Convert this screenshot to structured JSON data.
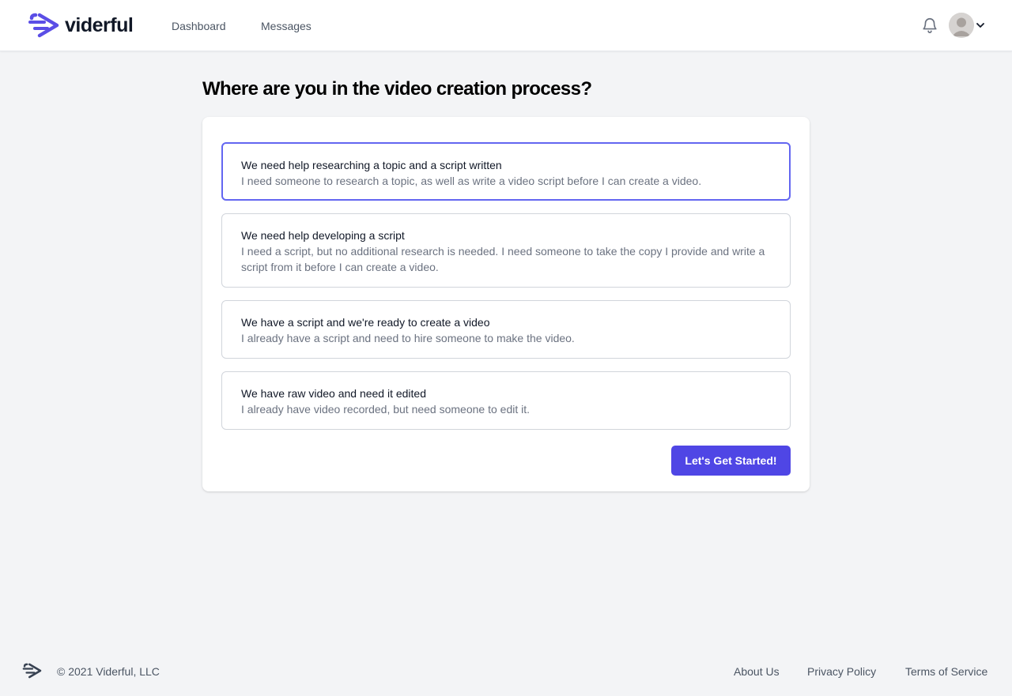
{
  "header": {
    "brand": "viderful",
    "nav": [
      "Dashboard",
      "Messages"
    ],
    "icons": {
      "logo": "viderful-logo-icon",
      "notifications": "bell-icon",
      "avatar": "user-avatar-icon",
      "menu": "chevron-down-icon"
    }
  },
  "main": {
    "title": "Where are you in the video creation process?",
    "options": [
      {
        "title": "We need help researching a topic and a script written",
        "description": "I need someone to research a topic, as well as write a video script before I can create a video.",
        "selected": true
      },
      {
        "title": "We need help developing a script",
        "description": "I need a script, but no additional research is needed. I need someone to take the copy I provide and write a script from it before I can create a video.",
        "selected": false
      },
      {
        "title": "We have a script and we're ready to create a video",
        "description": "I already have a script and need to hire someone to make the video.",
        "selected": false
      },
      {
        "title": "We have raw video and need it edited",
        "description": "I already have video recorded, but need someone to edit it.",
        "selected": false
      }
    ],
    "cta_label": "Let's Get Started!"
  },
  "footer": {
    "copyright": "© 2021 Viderful, LLC",
    "links": [
      "About Us",
      "Privacy Policy",
      "Terms of Service"
    ]
  },
  "colors": {
    "accent": "#4f46e5",
    "selected_border": "#6366f1",
    "background": "#f3f4f6"
  }
}
